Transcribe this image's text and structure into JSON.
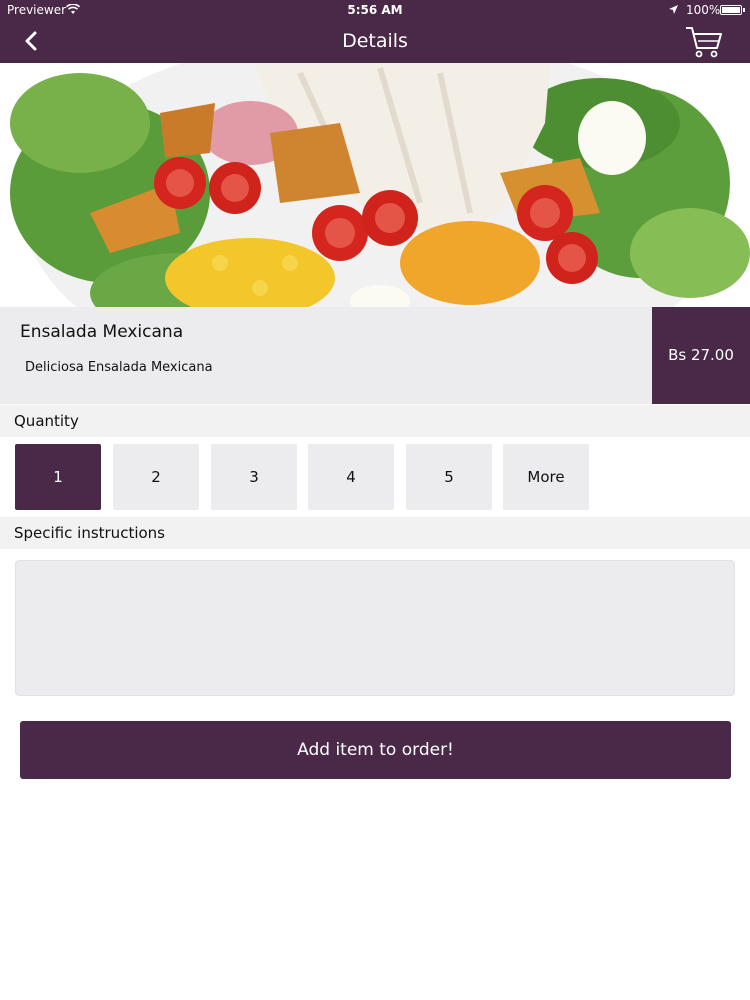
{
  "status_bar": {
    "carrier": "Previewer",
    "time": "5:56 AM",
    "battery": "100%"
  },
  "nav": {
    "title": "Details",
    "back_icon": "chevron-left-icon",
    "cart_icon": "shopping-cart-icon"
  },
  "product": {
    "image": "salad-photo",
    "name": "Ensalada Mexicana",
    "description": "Deliciosa Ensalada Mexicana",
    "price": "Bs 27.00"
  },
  "quantity": {
    "label": "Quantity",
    "options": [
      "1",
      "2",
      "3",
      "4",
      "5",
      "More"
    ],
    "selected": "1"
  },
  "instructions": {
    "label": "Specific instructions",
    "value": ""
  },
  "add_button": {
    "label": "Add item to order!"
  },
  "colors": {
    "primary": "#4a2848",
    "panel": "#ececee",
    "background": "#ffffff"
  }
}
